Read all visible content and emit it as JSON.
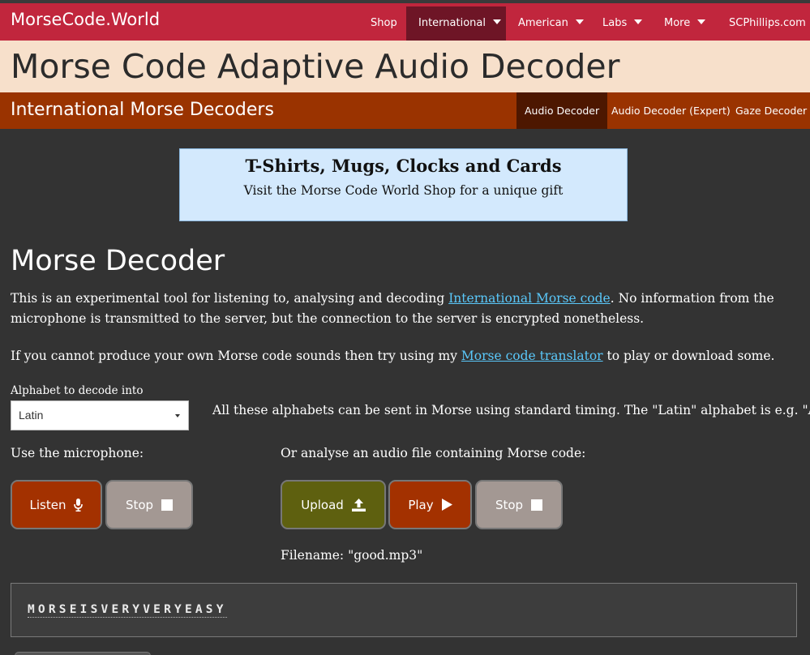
{
  "nav": {
    "brand": "MorseCode.World",
    "items": [
      {
        "label": "Shop",
        "dropdown": false
      },
      {
        "label": "International",
        "dropdown": true,
        "active": true
      },
      {
        "label": "American",
        "dropdown": true
      },
      {
        "label": "Labs",
        "dropdown": true
      },
      {
        "label": "More",
        "dropdown": true
      },
      {
        "label": "SCPhillips.com",
        "dropdown": false
      }
    ]
  },
  "page_title": "Morse Code Adaptive Audio Decoder",
  "subnav": {
    "title": "International Morse Decoders",
    "items": [
      {
        "label": "Audio Decoder",
        "active": true
      },
      {
        "label": "Audio Decoder (Expert)"
      },
      {
        "label": "Gaze Decoder"
      }
    ]
  },
  "ad": {
    "title": "T-Shirts, Mugs, Clocks and Cards",
    "subtitle": "Visit the Morse Code World Shop for a unique gift"
  },
  "section_title": "Morse Decoder",
  "intro": {
    "p1_before": "This is an experimental tool for listening to, analysing and decoding ",
    "p1_link": "International Morse code",
    "p1_after": ". No information from the microphone is transmitted to the server, but the connection to the server is encrypted nonetheless.",
    "p2_before": "If you cannot produce your own Morse code sounds then try using my ",
    "p2_link": "Morse code translator",
    "p2_after": " to play or download some."
  },
  "alphabet": {
    "label": "Alphabet to decode into",
    "selected": "Latin",
    "note": "All these alphabets can be sent in Morse using standard timing. The \"Latin\" alphabet is e.g. \"ABC\"."
  },
  "microphone": {
    "label": "Use the microphone:",
    "listen_label": "Listen",
    "stop_label": "Stop"
  },
  "file": {
    "label": "Or analyse an audio file containing Morse code:",
    "upload_label": "Upload",
    "play_label": "Play",
    "stop_label": "Stop",
    "filename": "Filename: \"good.mp3\""
  },
  "output": {
    "decoded_text": "MORSEISVERYVERYEASY"
  },
  "colors": {
    "topbar": "#c1263d",
    "title_band": "#f7e0cb",
    "subbar": "#9a3300",
    "background": "#333333",
    "link": "#5ac8fa",
    "button_red": "#a33100",
    "button_grey": "#a39893",
    "button_olive": "#5e600f"
  },
  "icons": {
    "listen": "microphone-icon",
    "stop": "stop-square-icon",
    "upload": "upload-icon",
    "play": "play-triangle-icon"
  }
}
